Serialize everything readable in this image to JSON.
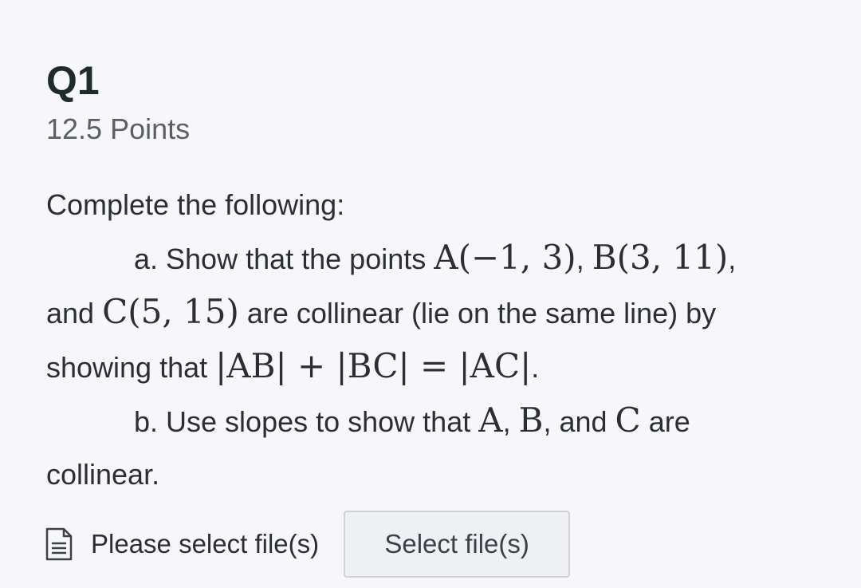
{
  "question": {
    "title": "Q1",
    "points": "12.5 Points",
    "intro": "Complete the following:",
    "part_a": {
      "lead": "a. Show that the points ",
      "point_a": "A(−1, 3)",
      "sep1": ", ",
      "point_b": "B(3, 11)",
      "sep2": ",",
      "and_text": "and ",
      "point_c": "C(5, 15)",
      "mid": " are collinear (lie on the same line) by",
      "showing": "showing that ",
      "equation": "|AB| + |BC| = |AC|",
      "end": "."
    },
    "part_b": {
      "lead": "b. Use slopes to show that ",
      "a": "A",
      "sep1": ", ",
      "b": "B",
      "sep2": ", and ",
      "c": "C",
      "tail": " are",
      "line2": "collinear."
    }
  },
  "upload": {
    "icon": "file-icon",
    "status": "Please select file(s)",
    "button_label": "Select file(s)"
  }
}
